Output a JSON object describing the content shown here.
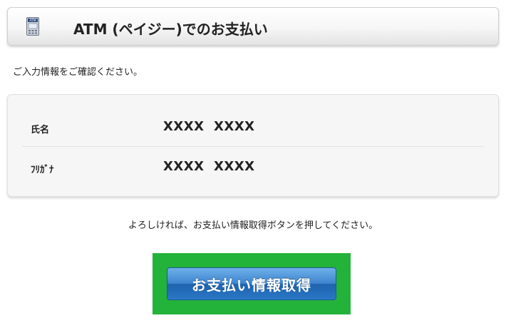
{
  "header": {
    "title": "ATM (ペイジー)でのお支払い",
    "icon": "atm-icon",
    "icon_label": "ATM"
  },
  "instruction": "ご入力情報をご確認ください。",
  "info": {
    "rows": [
      {
        "label": "氏名",
        "value": "XXXX  XXXX"
      },
      {
        "label": "ﾌﾘｶﾞﾅ",
        "value": "XXXX  XXXX"
      }
    ]
  },
  "confirm_text": "よろしければ、お支払い情報取得ボタンを押してください。",
  "submit": {
    "label": "お支払い情報取得"
  },
  "colors": {
    "highlight": "#23b23a",
    "button_top": "#6fb0ea",
    "button_bottom": "#1e63ad"
  }
}
